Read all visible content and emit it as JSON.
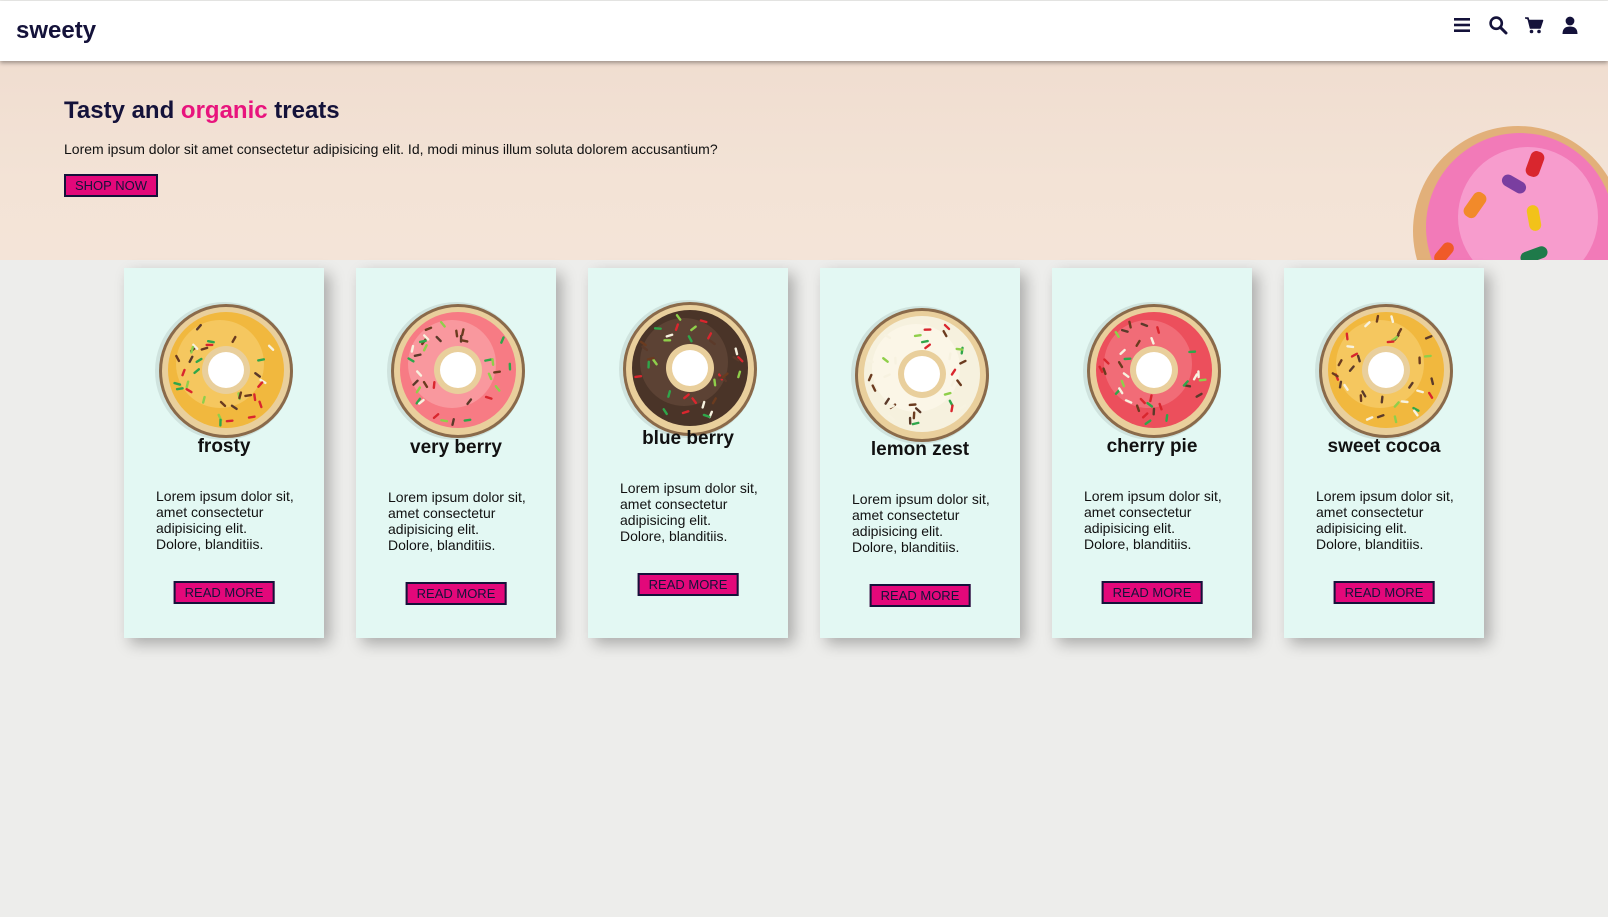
{
  "brand": {
    "name": "sweety"
  },
  "nav": {
    "icons": [
      "menu-icon",
      "search-icon",
      "cart-icon",
      "user-icon"
    ]
  },
  "hero": {
    "title_pre": "Tasty and ",
    "title_accent": "organic",
    "title_post": " treats",
    "text": "Lorem ipsum dolor sit amet consectetur adipisicing elit. Id, modi minus illum soluta dolorem accusantium?",
    "button": "SHOP NOW"
  },
  "colors": {
    "accent": "#e3087a",
    "navy": "#14123a",
    "card_bg": "#e3f8f3"
  },
  "cards": [
    {
      "title": "frosty",
      "text": "Lorem ipsum dolor sit, amet consectetur adipisicing elit. Dolore, blanditiis.",
      "button": "READ MORE",
      "glaze": "#f1b83e",
      "glaze_hi": "#f7d37a"
    },
    {
      "title": "very berry",
      "text": "Lorem ipsum dolor sit, amet consectetur adipisicing elit. Dolore, blanditiis.",
      "button": "READ MORE",
      "glaze": "#f77b84",
      "glaze_hi": "#fbb0b5"
    },
    {
      "title": "blue berry",
      "text": "Lorem ipsum dolor sit, amet consectetur adipisicing elit. Dolore, blanditiis.",
      "button": "READ MORE",
      "glaze": "#4a3428",
      "glaze_hi": "#6b4e3e"
    },
    {
      "title": "lemon zest",
      "text": "Lorem ipsum dolor sit, amet consectetur adipisicing elit. Dolore, blanditiis.",
      "button": "READ MORE",
      "glaze": "#f6f1de",
      "glaze_hi": "#fffaee"
    },
    {
      "title": "cherry pie",
      "text": "Lorem ipsum dolor sit, amet consectetur adipisicing elit. Dolore, blanditiis.",
      "button": "READ MORE",
      "glaze": "#ec4f5c",
      "glaze_hi": "#f5858e"
    },
    {
      "title": "sweet cocoa",
      "text": "Lorem ipsum dolor sit, amet consectetur adipisicing elit. Dolore, blanditiis.",
      "button": "READ MORE",
      "glaze": "#f1b83e",
      "glaze_hi": "#f7d37a"
    }
  ]
}
